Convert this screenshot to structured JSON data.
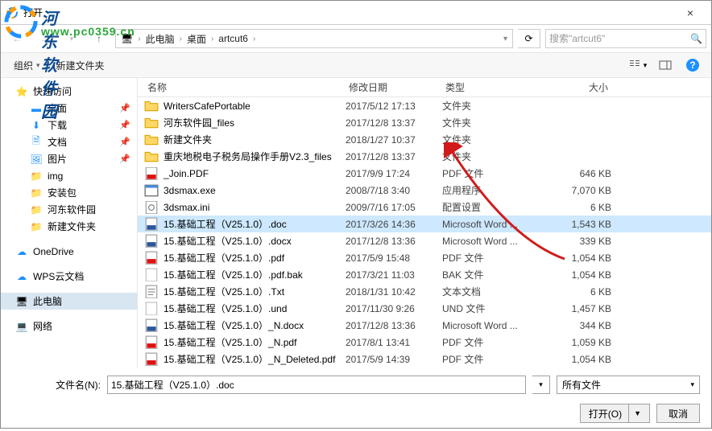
{
  "window": {
    "title": "打开",
    "close": "×"
  },
  "watermark": {
    "line1": "河东软件园",
    "line2": "www.pc0359.cn"
  },
  "nav": {
    "up_disabled": true,
    "crumbs": [
      "此电脑",
      "桌面",
      "artcut6"
    ],
    "search_placeholder": "搜索\"artcut6\""
  },
  "toolbar": {
    "organize": "组织",
    "newfolder": "新建文件夹"
  },
  "sidebar": {
    "quick": "快速访问",
    "items_pinned": [
      "桌面",
      "下载",
      "文档",
      "图片"
    ],
    "items": [
      "img",
      "安装包",
      "河东软件园",
      "新建文件夹"
    ],
    "onedrive": "OneDrive",
    "wps": "WPS云文档",
    "thispc": "此电脑",
    "network": "网络"
  },
  "headers": {
    "name": "名称",
    "date": "修改日期",
    "type": "类型",
    "size": "大小"
  },
  "files": [
    {
      "ico": "folder",
      "name": "WritersCafePortable",
      "date": "2017/5/12 17:13",
      "type": "文件夹",
      "size": ""
    },
    {
      "ico": "folder",
      "name": "河东软件园_files",
      "date": "2017/12/8 13:37",
      "type": "文件夹",
      "size": ""
    },
    {
      "ico": "folder",
      "name": "新建文件夹",
      "date": "2018/1/27 10:37",
      "type": "文件夹",
      "size": ""
    },
    {
      "ico": "folder",
      "name": "重庆地税电子税务局操作手册V2.3_files",
      "date": "2017/12/8 13:37",
      "type": "文件夹",
      "size": ""
    },
    {
      "ico": "pdf",
      "name": "_Join.PDF",
      "date": "2017/9/9 17:24",
      "type": "PDF 文件",
      "size": "646 KB"
    },
    {
      "ico": "exe",
      "name": "3dsmax.exe",
      "date": "2008/7/18 3:40",
      "type": "应用程序",
      "size": "7,070 KB"
    },
    {
      "ico": "ini",
      "name": "3dsmax.ini",
      "date": "2009/7/16 17:05",
      "type": "配置设置",
      "size": "6 KB"
    },
    {
      "ico": "doc",
      "name": "15.基础工程（V25.1.0）.doc",
      "date": "2017/3/26 14:36",
      "type": "Microsoft Word ...",
      "size": "1,543 KB",
      "selected": true
    },
    {
      "ico": "doc",
      "name": "15.基础工程（V25.1.0）.docx",
      "date": "2017/12/8 13:36",
      "type": "Microsoft Word ...",
      "size": "339 KB"
    },
    {
      "ico": "pdf",
      "name": "15.基础工程（V25.1.0）.pdf",
      "date": "2017/5/9 15:48",
      "type": "PDF 文件",
      "size": "1,054 KB"
    },
    {
      "ico": "bak",
      "name": "15.基础工程（V25.1.0）.pdf.bak",
      "date": "2017/3/21 11:03",
      "type": "BAK 文件",
      "size": "1,054 KB"
    },
    {
      "ico": "txt",
      "name": "15.基础工程（V25.1.0）.Txt",
      "date": "2018/1/31 10:42",
      "type": "文本文档",
      "size": "6 KB"
    },
    {
      "ico": "und",
      "name": "15.基础工程（V25.1.0）.und",
      "date": "2017/11/30 9:26",
      "type": "UND 文件",
      "size": "1,457 KB"
    },
    {
      "ico": "doc",
      "name": "15.基础工程（V25.1.0）_N.docx",
      "date": "2017/12/8 13:36",
      "type": "Microsoft Word ...",
      "size": "344 KB"
    },
    {
      "ico": "pdf",
      "name": "15.基础工程（V25.1.0）_N.pdf",
      "date": "2017/8/1 13:41",
      "type": "PDF 文件",
      "size": "1,059 KB"
    },
    {
      "ico": "pdf",
      "name": "15.基础工程（V25.1.0）_N_Deleted.pdf",
      "date": "2017/5/9 14:39",
      "type": "PDF 文件",
      "size": "1,054 KB"
    }
  ],
  "footer": {
    "filename_label": "文件名(N):",
    "filename_value": "15.基础工程（V25.1.0）.doc",
    "filter": "所有文件",
    "open": "打开(O)",
    "cancel": "取消"
  },
  "colors": {
    "selection": "#cde8ff",
    "accent": "#1e90ff",
    "arrow": "#d11b1b"
  }
}
